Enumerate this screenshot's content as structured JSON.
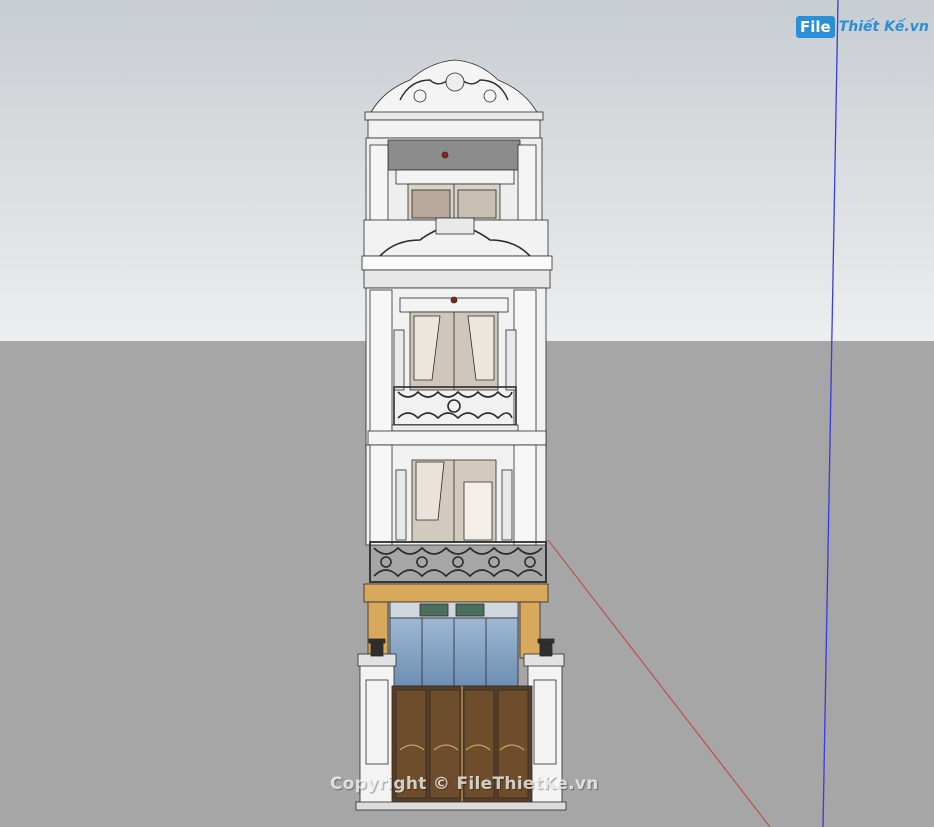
{
  "logo": {
    "mark": "File",
    "text": "Thiết Kế.vn"
  },
  "watermark": "Copyright © FileThietKe.vn",
  "colors": {
    "sky_top": "#c9ced3",
    "sky_bottom": "#e9ebec",
    "ground": "#a6a6a6",
    "blue_axis": "#3a3ae0",
    "red_axis": "#c04040",
    "wood": "#d8a95c",
    "door": "#5a3e24",
    "glass": "#86a7c8"
  },
  "icons": [
    "lamp-icon",
    "balcony-railing",
    "ornamental-crest"
  ]
}
